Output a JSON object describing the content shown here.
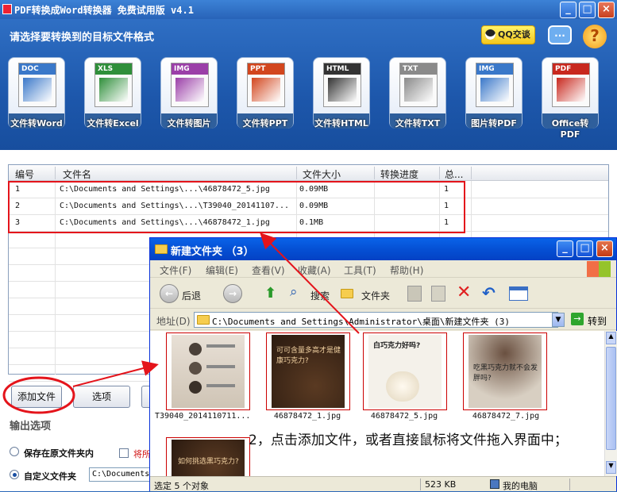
{
  "app": {
    "title": "PDF转换成Word转换器 免费试用版 v4.1",
    "prompt": "请选择要转换到的目标文件格式",
    "qq_label": "QQ交谈",
    "chat_icon_text": "...",
    "help_icon_text": "?",
    "tools": [
      {
        "band": "DOC",
        "label": "文件转Word",
        "color": "#3a78c9"
      },
      {
        "band": "XLS",
        "label": "文件转Excel",
        "color": "#2f8f3a"
      },
      {
        "band": "IMG",
        "label": "文件转图片",
        "color": "#9b3fa8"
      },
      {
        "band": "PPT",
        "label": "文件转PPT",
        "color": "#d2461e"
      },
      {
        "band": "HTML",
        "label": "文件转HTML",
        "color": "#333333"
      },
      {
        "band": "TXT",
        "label": "文件转TXT",
        "color": "#8a8a8a"
      },
      {
        "band": "IMG",
        "label": "图片转PDF",
        "color": "#3a78c9"
      },
      {
        "band": "PDF",
        "label": "Office转PDF",
        "color": "#c8281e"
      }
    ],
    "table": {
      "headers": [
        "编号",
        "文件名",
        "文件大小",
        "转换进度",
        "总..."
      ],
      "rows": [
        [
          "1",
          "C:\\Documents and Settings\\...\\46878472_5.jpg",
          "0.09MB",
          "",
          "1"
        ],
        [
          "2",
          "C:\\Documents and Settings\\...\\T39040_20141107...",
          "0.09MB",
          "",
          "1"
        ],
        [
          "3",
          "C:\\Documents and Settings\\...\\46878472_1.jpg",
          "0.1MB",
          "",
          "1"
        ]
      ]
    },
    "buttons": {
      "add_file": "添加文件",
      "options": "选项"
    },
    "output": {
      "title": "输出选项",
      "keep_folder": "保存在原文件夹内",
      "custom_folder": "自定义文件夹",
      "checkbox_label": "将所",
      "path": "C:\\Documents"
    }
  },
  "explorer": {
    "title": "新建文件夹 （3）",
    "menu": [
      "文件(F)",
      "编辑(E)",
      "查看(V)",
      "收藏(A)",
      "工具(T)",
      "帮助(H)"
    ],
    "toolbar": {
      "back": "后退",
      "search": "搜索",
      "folders": "文件夹"
    },
    "address_label": "地址(D)",
    "address": "C:\\Documents and Settings\\Administrator\\桌面\\新建文件夹 (3)",
    "go": "转到",
    "files": [
      {
        "name": "T39040_2014110711...",
        "caption": ""
      },
      {
        "name": "46878472_1.jpg",
        "caption": "可可含量多高才是健康巧克力?"
      },
      {
        "name": "46878472_5.jpg",
        "caption": "白巧克力好吗?"
      },
      {
        "name": "46878472_7.jpg",
        "caption": "吃黑巧克力就不会发胖吗?"
      }
    ],
    "extra_thumb_caption": "如何挑选黑巧克力?",
    "note": "2，点击添加文件，或者直接鼠标将文件拖入界面中；",
    "status": {
      "selected": "选定 5 个对象",
      "size": "523 KB",
      "location": "我的电脑"
    }
  }
}
